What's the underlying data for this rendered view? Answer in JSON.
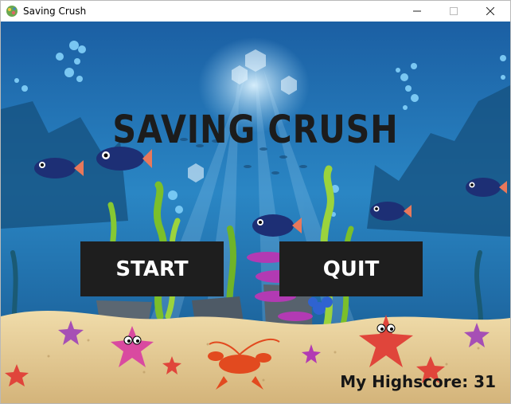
{
  "window": {
    "title": "Saving Crush",
    "controls": {
      "minimize": "minimize",
      "maximize": "maximize",
      "close": "close"
    }
  },
  "game": {
    "title": "SAVING CRUSH",
    "start_label": "START",
    "quit_label": "QUIT",
    "highscore_label": "My Highscore: 31"
  },
  "colors": {
    "button_bg": "#1e1e1e",
    "water_top": "#1f6fb0",
    "sand": "#e2c88f"
  }
}
